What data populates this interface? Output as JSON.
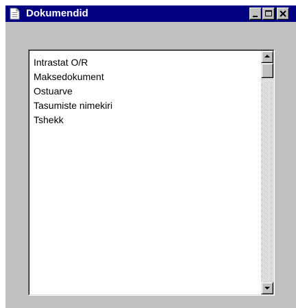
{
  "window": {
    "title": "Dokumendid",
    "icons": {
      "app": "document-icon",
      "minimize": "minimize-icon",
      "maximize": "maximize-icon",
      "close": "close-icon"
    }
  },
  "list": {
    "items": [
      "Intrastat O/R",
      "Maksedokument",
      "Ostuarve",
      "Tasumiste nimekiri",
      "Tshekk"
    ]
  },
  "scrollbar": {
    "up_icon": "arrow-up-icon",
    "down_icon": "arrow-down-icon"
  }
}
